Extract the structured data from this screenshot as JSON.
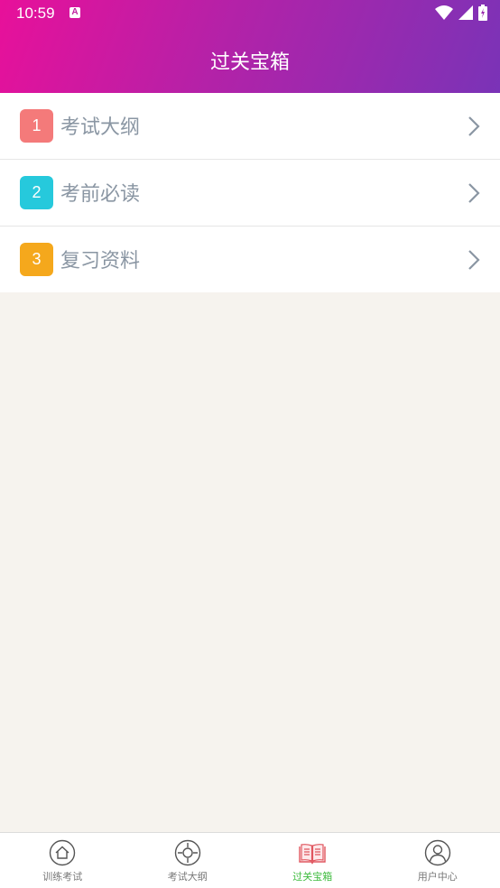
{
  "status_bar": {
    "time": "10:59",
    "notification_letter": "A"
  },
  "header": {
    "title": "过关宝箱"
  },
  "items": [
    {
      "number": "1",
      "label": "考试大纲",
      "color": "#f47a7a"
    },
    {
      "number": "2",
      "label": "考前必读",
      "color": "#26c9dc"
    },
    {
      "number": "3",
      "label": "复习资料",
      "color": "#f5a81c"
    }
  ],
  "tabbar": [
    {
      "label": "训练考试",
      "icon": "home-icon",
      "active": false
    },
    {
      "label": "考试大纲",
      "icon": "target-icon",
      "active": false
    },
    {
      "label": "过关宝箱",
      "icon": "book-icon",
      "active": true
    },
    {
      "label": "用户中心",
      "icon": "user-icon",
      "active": false
    }
  ],
  "colors": {
    "header_start": "#e8109a",
    "header_end": "#7a33b7",
    "active_tab": "#3dbb3d",
    "background": "#f6f3ee"
  }
}
